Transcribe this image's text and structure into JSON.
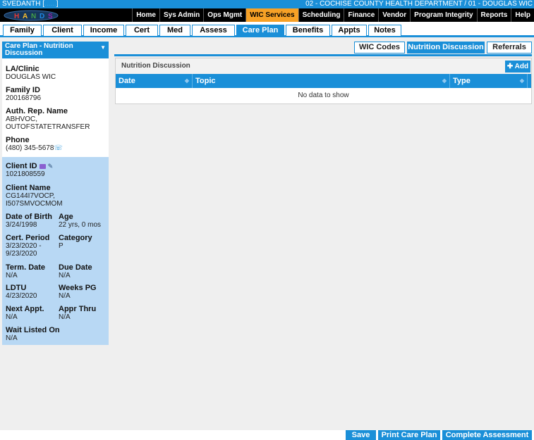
{
  "topbar": {
    "user": "SVEDANTH [",
    "user_dim": "......",
    "user_end": "]",
    "org": "02 - COCHISE COUNTY HEALTH DEPARTMENT / 01 - DOUGLAS WIC"
  },
  "logo": {
    "text": "HANDS",
    "colors": [
      "#e53935",
      "#fbc02d",
      "#43a047",
      "#1e88e5",
      "#8e24aa"
    ]
  },
  "mainnav": {
    "items": [
      "Home",
      "Sys Admin",
      "Ops Mgmt",
      "WIC Services",
      "Scheduling",
      "Finance",
      "Vendor",
      "Program Integrity",
      "Reports",
      "Help"
    ],
    "active": "WIC Services"
  },
  "subtabs": {
    "items": [
      "Family",
      "Client",
      "Income",
      "Cert",
      "Med",
      "Assess",
      "Care Plan",
      "Benefits",
      "Appts",
      "Notes"
    ],
    "active": "Care Plan"
  },
  "sidebar": {
    "header": "Care Plan - Nutrition Discussion",
    "la_clinic_label": "LA/Clinic",
    "la_clinic_value": "DOUGLAS WIC",
    "family_id_label": "Family ID",
    "family_id_value": "200168796",
    "auth_rep_label": "Auth. Rep. Name",
    "auth_rep_value_1": "ABHVOC,",
    "auth_rep_value_2": "OUTOFSTATETRANSFER",
    "phone_label": "Phone",
    "phone_value": "(480) 345-5678"
  },
  "client": {
    "client_id_label": "Client ID",
    "client_id_value": "1021808559",
    "client_name_label": "Client Name",
    "client_name_1": "CG144I7VOCP,",
    "client_name_2": "I507SMVOCMOM",
    "dob_label": "Date of Birth",
    "dob_value": "3/24/1998",
    "age_label": "Age",
    "age_value": "22 yrs, 0 mos",
    "cert_label": "Cert. Period",
    "cert_value_1": "3/23/2020 -",
    "cert_value_2": "9/23/2020",
    "category_label": "Category",
    "category_value": "P",
    "term_label": "Term. Date",
    "term_value": "N/A",
    "due_label": "Due Date",
    "due_value": "N/A",
    "ldtu_label": "LDTU",
    "ldtu_value": "4/23/2020",
    "weeks_label": "Weeks PG",
    "weeks_value": "N/A",
    "next_label": "Next Appt.",
    "next_value": "N/A",
    "appr_label": "Appr Thru",
    "appr_value": "N/A",
    "wait_label": "Wait Listed On",
    "wait_value": "N/A"
  },
  "rtabs": {
    "items": [
      "WIC Codes",
      "Nutrition Discussion",
      "Referrals"
    ],
    "active": "Nutrition Discussion"
  },
  "panel": {
    "title": "Nutrition Discussion",
    "add_label": "Add",
    "columns": [
      "Date",
      "Topic",
      "Type"
    ],
    "empty_text": "No data to show"
  },
  "bottom": {
    "save": "Save",
    "print": "Print Care Plan",
    "complete": "Complete Assessment"
  }
}
